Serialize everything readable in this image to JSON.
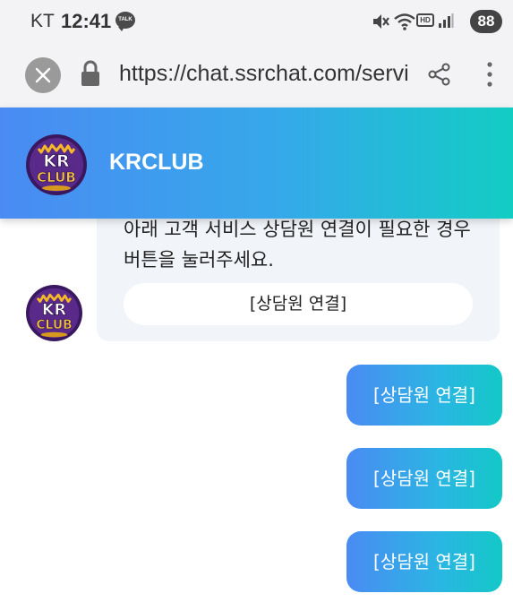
{
  "status_bar": {
    "carrier": "KT",
    "time": "12:41",
    "talk_badge": "TALK",
    "hd_label": "HD",
    "battery": "88",
    "icons": [
      "mute-icon",
      "wifi-icon",
      "hd-icon",
      "signal-icon",
      "battery-icon"
    ]
  },
  "browser": {
    "url": "https://chat.ssrchat.com/service",
    "icons": [
      "close-icon",
      "lock-icon",
      "share-icon",
      "more-icon"
    ]
  },
  "header": {
    "title": "KRCLUB",
    "logo_text_top": "KR",
    "logo_text_bottom": "CLUB"
  },
  "chat": {
    "bot_message": {
      "line1": "아래 고객 서비스 상담원 연결이 필요한 경우",
      "line2": "버튼을 눌러주세요.",
      "button_label": "[상담원 연결]"
    },
    "user_messages": [
      {
        "text": "[상담원 연결]"
      },
      {
        "text": "[상담원 연결]"
      },
      {
        "text": "[상담원 연결]"
      }
    ]
  },
  "colors": {
    "header_gradient_start": "#4a8bf3",
    "header_gradient_end": "#12cdc4",
    "bot_bubble": "#f1f4f9",
    "logo_purple": "#5a2a8a",
    "logo_gold": "#f4b829"
  }
}
